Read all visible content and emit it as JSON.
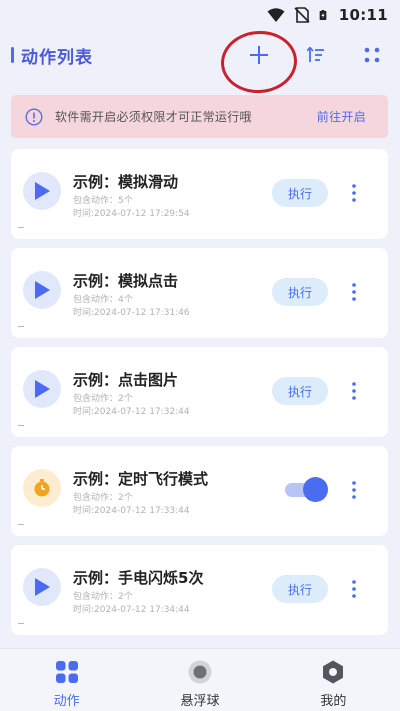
{
  "status_bar": {
    "time": "10:11"
  },
  "header": {
    "title": "动作列表"
  },
  "banner": {
    "text": "软件需开启必须权限才可正常运行哦",
    "link": "前往开启"
  },
  "cards": [
    {
      "title": "示例：模拟滑动",
      "count_label": "包含动作：",
      "count": "5个",
      "time_label": "时间:",
      "time": "2024-07-12 17:29:54",
      "icon": "play-icon",
      "action": "执行"
    },
    {
      "title": "示例：模拟点击",
      "count_label": "包含动作：",
      "count": "4个",
      "time_label": "时间:",
      "time": "2024-07-12 17:31:46",
      "icon": "play-icon",
      "action": "执行"
    },
    {
      "title": "示例：点击图片",
      "count_label": "包含动作：",
      "count": "2个",
      "time_label": "时间:",
      "time": "2024-07-12 17:32:44",
      "icon": "play-icon",
      "action": "执行"
    },
    {
      "title": "示例：定时飞行模式",
      "count_label": "包含动作：",
      "count": "2个",
      "time_label": "时间:",
      "time": "2024-07-12 17:33:44",
      "icon": "timer-icon",
      "toggle_on": true
    },
    {
      "title": "示例：手电闪烁5次",
      "count_label": "包含动作：",
      "count": "2个",
      "time_label": "时间:",
      "time": "2024-07-12 17:34:44",
      "icon": "play-icon",
      "action": "执行"
    }
  ],
  "bottom_nav": [
    {
      "label": "动作",
      "icon": "grid-icon",
      "active": true
    },
    {
      "label": "悬浮球",
      "icon": "float-ball-icon",
      "active": false
    },
    {
      "label": "我的",
      "icon": "hexagon-icon",
      "active": false
    }
  ],
  "colors": {
    "accent": "#4a6cf0",
    "background": "#eef0fa",
    "banner_bg": "#f5d6dc",
    "annotation_circle": "#c8222c"
  }
}
